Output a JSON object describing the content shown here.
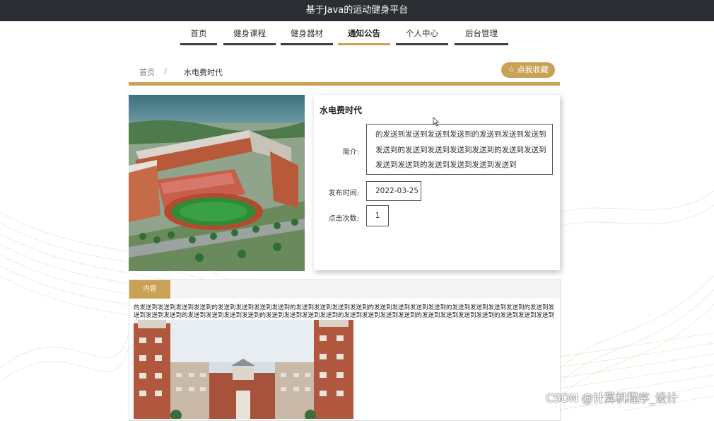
{
  "site_title": "基于Java的运动健身平台",
  "nav": [
    {
      "label": "首页",
      "active": false
    },
    {
      "label": "健身课程",
      "active": false
    },
    {
      "label": "健身器材",
      "active": false
    },
    {
      "label": "通知公告",
      "active": true
    },
    {
      "label": "个人中心",
      "active": false
    },
    {
      "label": "后台管理",
      "active": false
    }
  ],
  "breadcrumb": {
    "home": "首页",
    "separator": "/",
    "current": "水电费时代"
  },
  "favorite_button": "☆ 点我收藏",
  "notice": {
    "title": "水电费时代",
    "intro_label": "简介:",
    "intro_lines": [
      "的发送到发送到发送到发送到的发送到发送到发送到",
      "发送到的发送到发送到发送到发送到的发送到发送到",
      "发送到发送到的发送到发送到发送到发送到"
    ],
    "time_label": "发布时间:",
    "time_value": "2022-03-25",
    "clicks_label": "点击次数:",
    "clicks_value": "1"
  },
  "content": {
    "tab_label": "内容",
    "text": "的发送到发送到发送到发送到的发送到发送到发送到发送到的发送到发送到发送到发送到的发送到发送到发送到发送到的发送到发送到发送到发送到的发送到发送到发送到发送到的发送到发送到发送到发送到的发送到发送到发送到发送到的发送到发送到发送到发送到的发送到发送到发送到发送到的发送到发送到发送到发送到"
  },
  "watermark": "CSDN @计算机程序_设计",
  "colors": {
    "accent": "#c9a255",
    "topbar": "#2b2e33",
    "nav_underline": "#3a3d42"
  },
  "icons": {
    "cursor": "mouse-pointer-icon",
    "favorite": "star-outline-icon"
  }
}
